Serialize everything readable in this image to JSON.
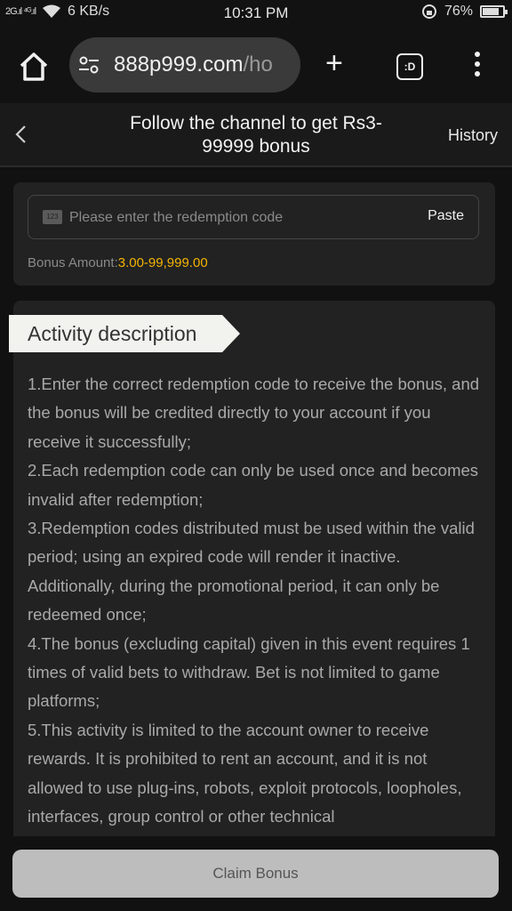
{
  "status_bar": {
    "signal_text": "2G.ıl ⁴ᴳ.ıl",
    "speed": "6 KB/s",
    "time": "10:31 PM",
    "battery_percent": "76%"
  },
  "browser": {
    "url_host": "888p999.com",
    "url_path": "/ho",
    "tabs_label": ":D"
  },
  "header": {
    "title": "Follow the channel to get Rs3-99999 bonus",
    "history_label": "History"
  },
  "redeem": {
    "icon_text": "123",
    "placeholder": "Please enter the redemption code",
    "paste_label": "Paste",
    "bonus_label": "Bonus Amount:",
    "bonus_value": "3.00-99,999.00"
  },
  "description": {
    "heading": "Activity description",
    "items": [
      "1.Enter the correct redemption code to receive the bonus, and the bonus will be credited directly to your account if you receive it successfully;",
      "2.Each redemption code can only be used once and becomes invalid after redemption;",
      "3.Redemption codes distributed must be used within the valid period; using an expired code will render it inactive. Additionally, during the promotional period, it can only be redeemed once;",
      "4.The bonus (excluding capital) given in this event requires 1 times of valid bets to withdraw. Bet is not limited to game platforms;",
      "5.This activity is limited to the account owner to receive rewards. It is prohibited to rent an account, and it is not allowed to use plug-ins, robots, exploit protocols, loopholes, interfaces, group control or other technical"
    ]
  },
  "footer": {
    "claim_label": "Claim Bonus"
  },
  "colors": {
    "accent_amount": "#f4b400",
    "background": "#111111",
    "card": "#222222"
  }
}
